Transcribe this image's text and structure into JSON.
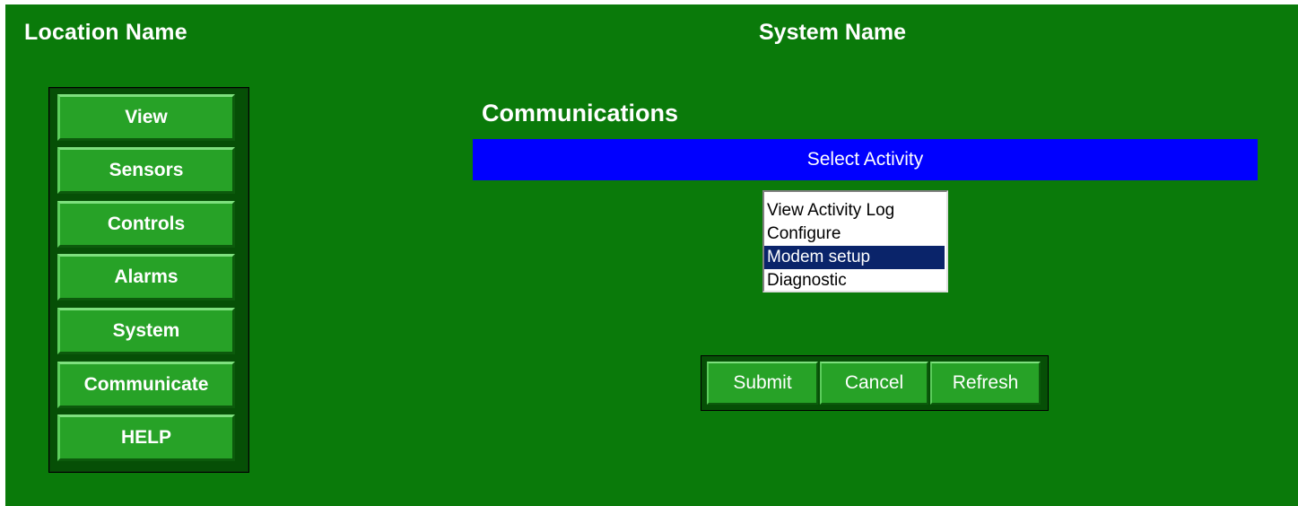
{
  "header": {
    "location_name": "Location Name",
    "system_name": "System Name"
  },
  "nav": {
    "items": [
      {
        "label": "View"
      },
      {
        "label": "Sensors"
      },
      {
        "label": "Controls"
      },
      {
        "label": "Alarms"
      },
      {
        "label": "System"
      },
      {
        "label": "Communicate"
      },
      {
        "label": "HELP"
      }
    ]
  },
  "main": {
    "title": "Communications",
    "activity_header": "Select Activity",
    "activities": [
      {
        "label": "View Activity Log"
      },
      {
        "label": "Configure"
      },
      {
        "label": "Modem setup"
      },
      {
        "label": "Diagnostic"
      }
    ],
    "selected_activity": "Modem setup"
  },
  "actions": {
    "submit_label": "Submit",
    "cancel_label": "Cancel",
    "refresh_label": "Refresh"
  },
  "colors": {
    "background": "#0a7a0a",
    "button": "#27a227",
    "header_bar": "#0000ff",
    "selection": "#0a246a"
  }
}
